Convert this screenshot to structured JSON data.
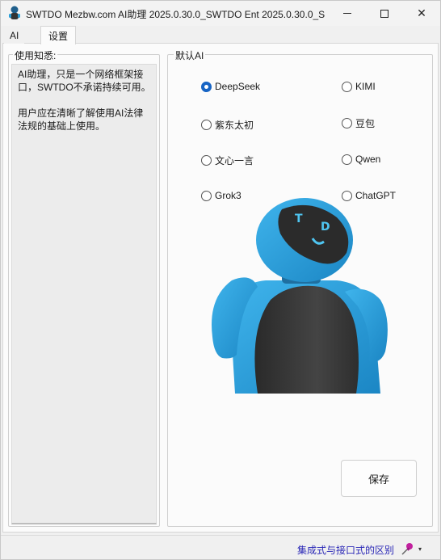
{
  "window": {
    "title": "SWTDO Mezbw.com AI助理  2025.0.30.0_SWTDO Ent  2025.0.30.0_S...",
    "min_icon": "minimize-icon",
    "max_icon": "maximize-icon",
    "close_icon": "close-icon",
    "close_glyph": "✕"
  },
  "tabs": [
    {
      "label": "AI",
      "selected": false
    },
    {
      "label": "设置",
      "selected": true
    }
  ],
  "notice": {
    "title": "使用知悉:",
    "paragraph1": "  AI助理，只是一个网络框架接口，SWTDO不承诺持续可用。",
    "paragraph2": "  用户应在清晰了解使用AI法律法规的基础上使用。"
  },
  "default_ai": {
    "title": "默认AI",
    "options": [
      {
        "label": "DeepSeek",
        "checked": true
      },
      {
        "label": "KIMI",
        "checked": false
      },
      {
        "label": "紫东太初",
        "checked": false
      },
      {
        "label": "豆包",
        "checked": false
      },
      {
        "label": "文心一言",
        "checked": false
      },
      {
        "label": "Qwen",
        "checked": false
      },
      {
        "label": "Grok3",
        "checked": false
      },
      {
        "label": "ChatGPT",
        "checked": false
      }
    ],
    "robot_face_text": "T D",
    "save_label": "保存"
  },
  "statusbar": {
    "link_text": "集成式与接口式的区别",
    "pin_icon": "pin-icon",
    "dropdown_glyph": "▾"
  },
  "colors": {
    "accent": "#1764c4",
    "link": "#2a27b6",
    "robot_blue": "#2b9fd8",
    "robot_dark": "#3a3a3a"
  }
}
